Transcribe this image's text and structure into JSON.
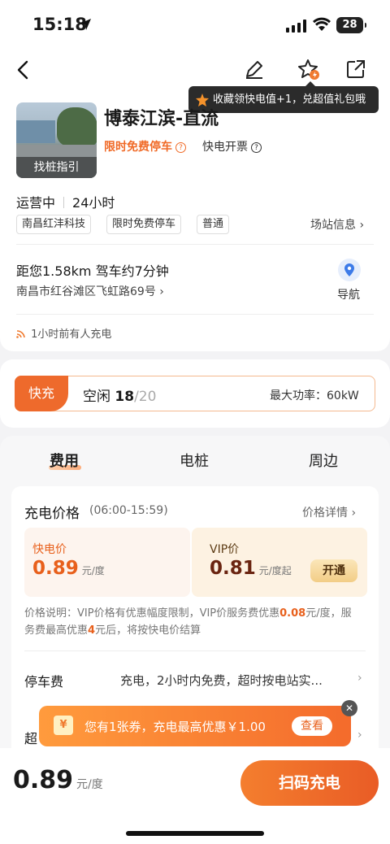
{
  "status_bar": {
    "time": "15:18",
    "battery": "28"
  },
  "tooltip": {
    "text": "收藏领快电值+1，兑超值礼包哦"
  },
  "station": {
    "photo_caption": "找桩指引",
    "name": "博泰江滨-直流",
    "free_parking": "限时免费停车",
    "fast_invoice": "快电开票",
    "status": "运营中",
    "hours": "24小时",
    "tags": [
      "南昌红沣科技",
      "限时免费停车",
      "普通"
    ],
    "station_info": "场站信息",
    "distance": "距您1.58km  驾车约7分钟",
    "address": "南昌市红谷滩区飞虹路69号",
    "navigate": "导航",
    "recent_activity": "1小时前有人充电"
  },
  "piles": {
    "type": "快充",
    "idle_label": "空闲",
    "idle": "18",
    "total": "/20",
    "max_power": "最大功率：60kW"
  },
  "tabs": [
    "费用",
    "电桩",
    "周边"
  ],
  "price": {
    "title": "充电价格",
    "hours": "(06:00-15:59)",
    "detail_link": "价格详情",
    "fast_label": "快电价",
    "fast_value": "0.89",
    "fast_unit": "元/度",
    "vip_label": "VIP价",
    "vip_value": "0.81",
    "vip_unit": "元/度起",
    "open_button": "开通",
    "note_a": "价格说明：VIP价格有优惠幅度限制，VIP价服务费优惠",
    "note_hl1": "0.08",
    "note_b": "元/度，服务费最高优惠",
    "note_hl2": "4",
    "note_c": "元后，将按快电价结算"
  },
  "parking": {
    "label": "停车费",
    "value": "充电，2小时内免费，超时按电站实..."
  },
  "row2_label": "超",
  "coupon": {
    "icon": "¥",
    "text": "您有1张券，充电最高优惠￥1.00",
    "button": "查看",
    "close": "✕"
  },
  "bottom": {
    "price": "0.89",
    "unit": "元/度",
    "scan_button": "扫码充电"
  },
  "colors": {
    "accent": "#EE6A2C",
    "vip_dark": "#6A2410"
  }
}
